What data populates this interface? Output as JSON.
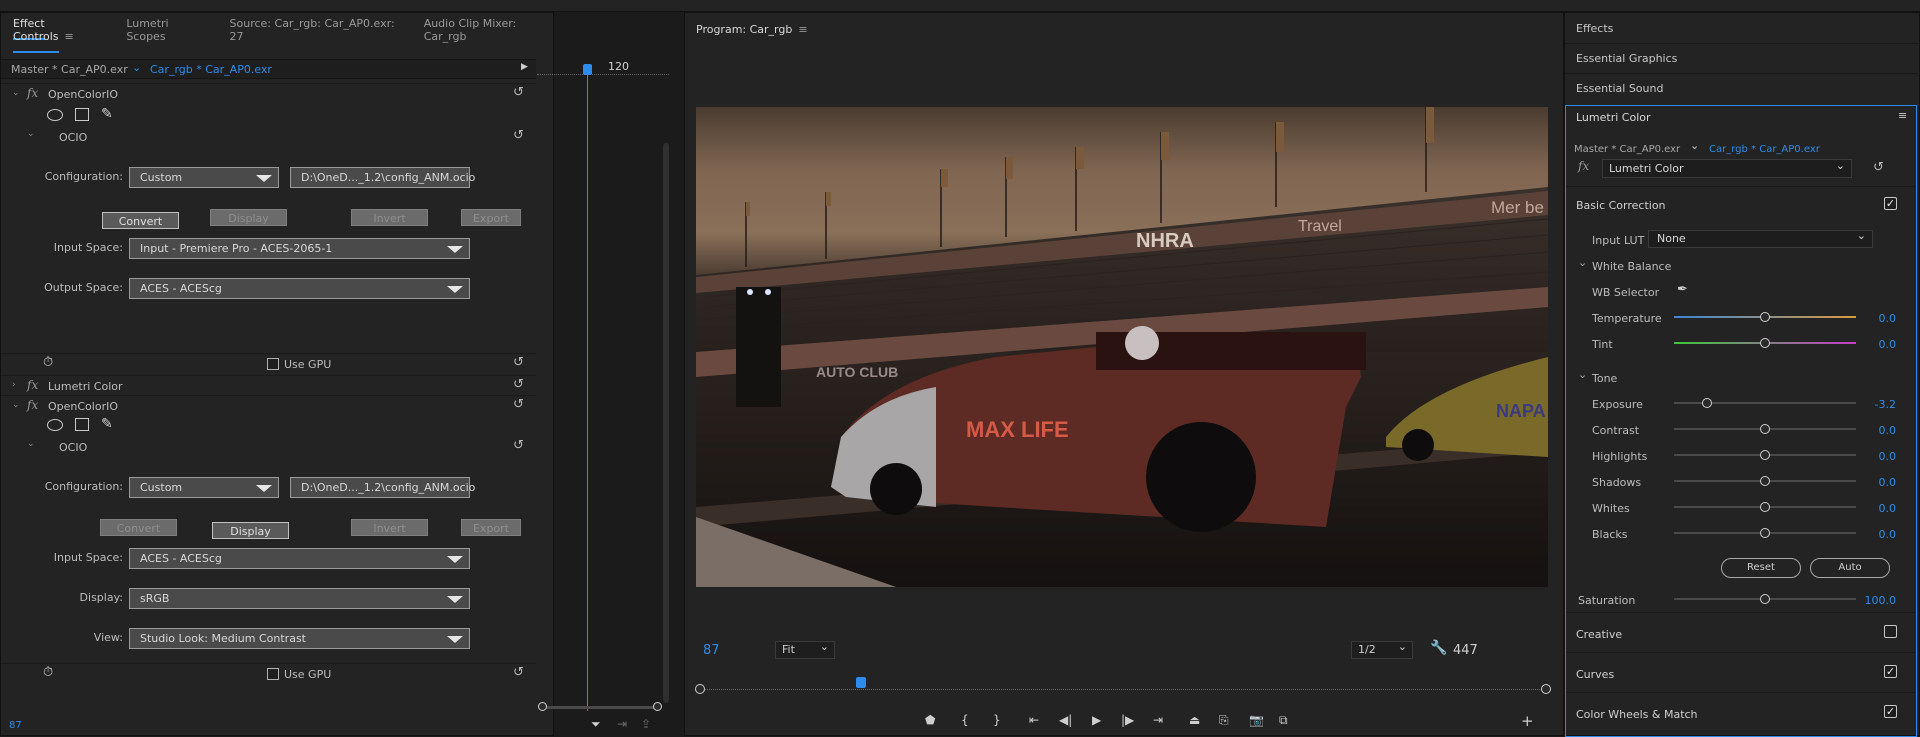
{
  "effect_controls_panel": {
    "tabs": [
      {
        "label": "Effect Controls"
      },
      {
        "label": "Lumetri Scopes"
      },
      {
        "label": "Source: Car_rgb: Car_AP0.exr: 27"
      },
      {
        "label": "Audio Clip Mixer: Car_rgb"
      }
    ],
    "master_clip": "Master * Car_AP0.exr",
    "sequence_clip": "Car_rgb * Car_AP0.exr",
    "timeline_time": "120",
    "current_time": "87",
    "effects": [
      {
        "name": "OpenColorIO",
        "sub": "OCIO",
        "configuration_label": "Configuration:",
        "configuration_value": "Custom",
        "config_path": "D:\\OneD..._1.2\\config_ANM.ocio",
        "buttons": [
          {
            "label": "Convert",
            "state": "on"
          },
          {
            "label": "Display",
            "state": "off"
          },
          {
            "label": "Invert",
            "state": "off"
          },
          {
            "label": "Export",
            "state": "off"
          }
        ],
        "fields": [
          {
            "label": "Input Space:",
            "value": "Input - Premiere Pro - ACES-2065-1"
          },
          {
            "label": "Output Space:",
            "value": "ACES - ACEScg"
          }
        ],
        "use_gpu_label": "Use GPU"
      },
      {
        "name": "Lumetri Color"
      },
      {
        "name": "OpenColorIO",
        "sub": "OCIO",
        "configuration_label": "Configuration:",
        "configuration_value": "Custom",
        "config_path": "D:\\OneD..._1.2\\config_ANM.ocio",
        "buttons": [
          {
            "label": "Convert",
            "state": "off"
          },
          {
            "label": "Display",
            "state": "on"
          },
          {
            "label": "Invert",
            "state": "off"
          },
          {
            "label": "Export",
            "state": "off"
          }
        ],
        "fields": [
          {
            "label": "Input Space:",
            "value": "ACES - ACEScg"
          },
          {
            "label": "Display:",
            "value": "sRGB"
          },
          {
            "label": "View:",
            "value": "Studio Look: Medium Contrast"
          }
        ],
        "use_gpu_label": "Use GPU"
      }
    ]
  },
  "program_monitor": {
    "title": "Program: Car_rgb",
    "timecode": "87",
    "zoom": "Fit",
    "resolution": "1/2",
    "duration": "447",
    "image_text": {
      "banner_1": "NHRA",
      "banner_2": "Travel",
      "banner_3": "Mer be",
      "banner_4": "AUTO CLUB",
      "car_1": "MAX LIFE",
      "car_2": "NAPA"
    },
    "transport_icons": [
      "marker-icon",
      "mark-in-icon",
      "mark-out-icon",
      "go-to-in-icon",
      "step-back-icon",
      "play-icon",
      "step-forward-icon",
      "go-to-out-icon",
      "lift-icon",
      "extract-icon",
      "export-frame-icon",
      "compare-icon",
      "add-button-icon"
    ],
    "playhead_fraction": 0.19
  },
  "right_panel": {
    "sections": [
      "Effects",
      "Essential Graphics",
      "Essential Sound"
    ],
    "lumetri": {
      "title": "Lumetri Color",
      "master_clip": "Master * Car_AP0.exr",
      "sequence_clip": "Car_rgb * Car_AP0.exr",
      "effect_dropdown": "Lumetri Color",
      "basic_correction": "Basic Correction",
      "input_lut_label": "Input LUT",
      "input_lut_value": "None",
      "white_balance": "White Balance",
      "wb_selector": "WB Selector",
      "temperature": {
        "label": "Temperature",
        "value": "0.0",
        "position": 0.5
      },
      "tint": {
        "label": "Tint",
        "value": "0.0",
        "position": 0.5
      },
      "tone": "Tone",
      "tone_sliders": [
        {
          "label": "Exposure",
          "value": "-3.2",
          "position": 0.18
        },
        {
          "label": "Contrast",
          "value": "0.0",
          "position": 0.5
        },
        {
          "label": "Highlights",
          "value": "0.0",
          "position": 0.5
        },
        {
          "label": "Shadows",
          "value": "0.0",
          "position": 0.5
        },
        {
          "label": "Whites",
          "value": "0.0",
          "position": 0.5
        },
        {
          "label": "Blacks",
          "value": "0.0",
          "position": 0.5
        }
      ],
      "reset_button": "Reset",
      "auto_button": "Auto",
      "saturation": {
        "label": "Saturation",
        "value": "100.0",
        "position": 0.5
      },
      "bottom_sections": [
        {
          "label": "Creative",
          "checked": false
        },
        {
          "label": "Curves",
          "checked": true
        },
        {
          "label": "Color Wheels & Match",
          "checked": true
        }
      ]
    }
  },
  "colors": {
    "accent": "#2d8ceb",
    "panel": "#232323",
    "field": "#4a4a4a"
  }
}
